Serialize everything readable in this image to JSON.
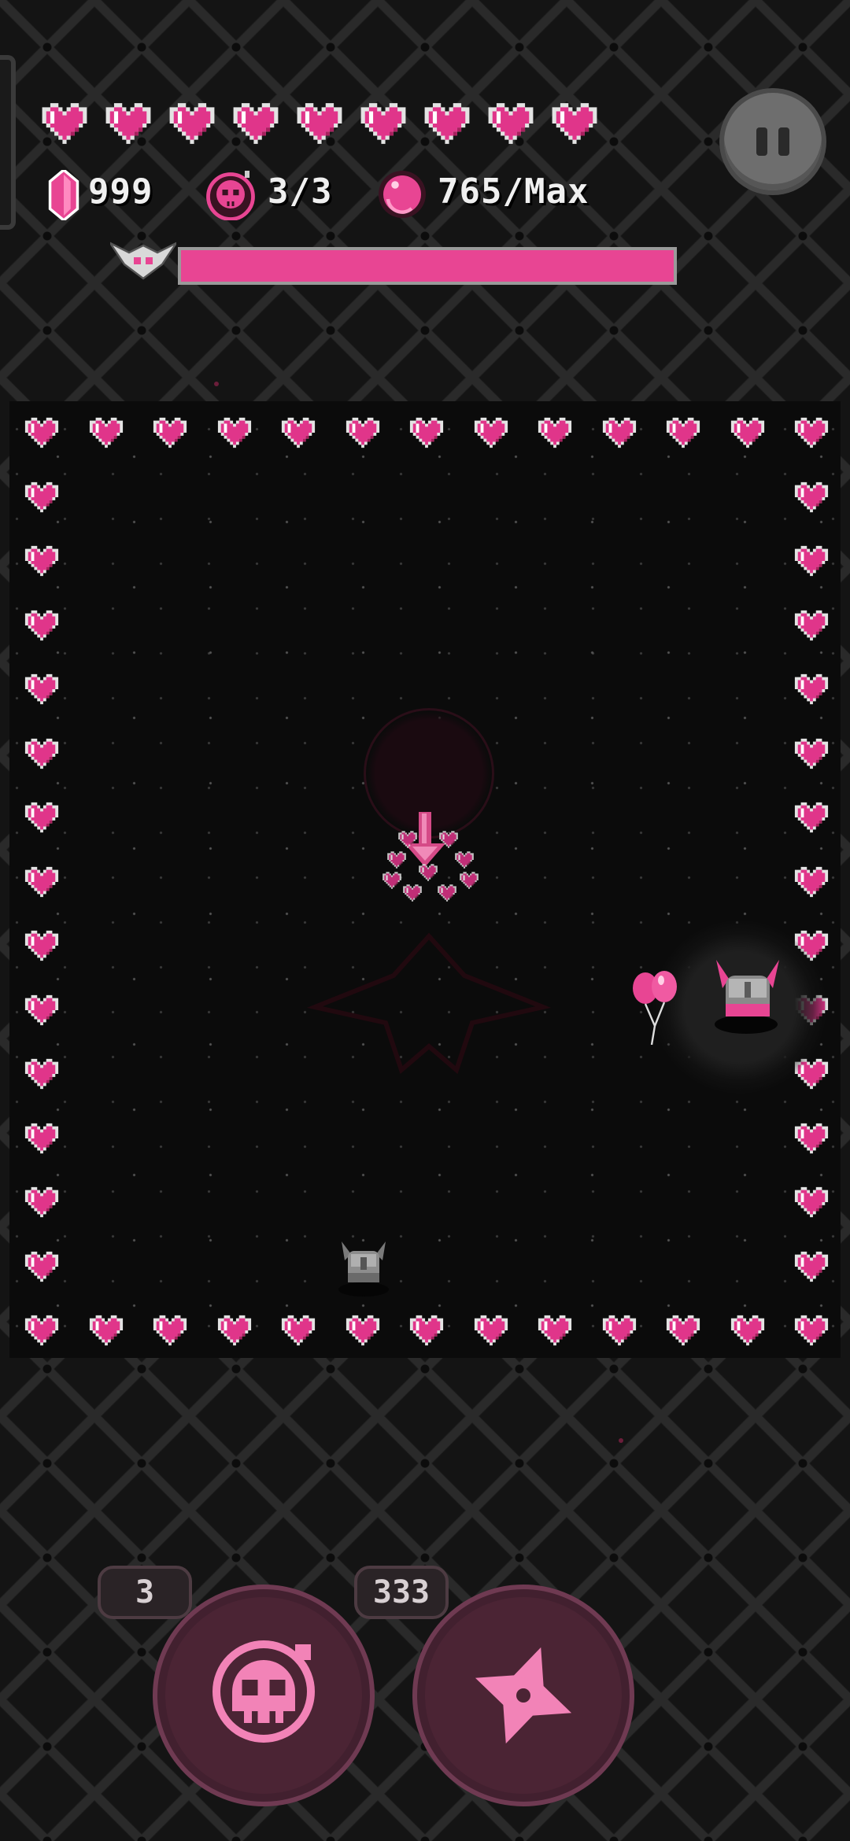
{
  "hud": {
    "lives": 9,
    "gems": "999",
    "bombs": "3/3",
    "orbs": "765/Max",
    "boss_health_fraction": 1.0
  },
  "skills": {
    "bomb_count": "3",
    "shuriken_count": "333"
  },
  "icons": {
    "life": "heart-icon",
    "gem": "crystal-icon",
    "bomb": "skull-bomb-icon",
    "orb": "orb-icon",
    "boss": "boss-emblem-icon",
    "pause": "pause-icon",
    "skill1": "skull-icon",
    "skill2": "shuriken-icon"
  },
  "colors": {
    "accent": "#e84593",
    "background": "#141414",
    "arena": "#0b0b0b"
  }
}
